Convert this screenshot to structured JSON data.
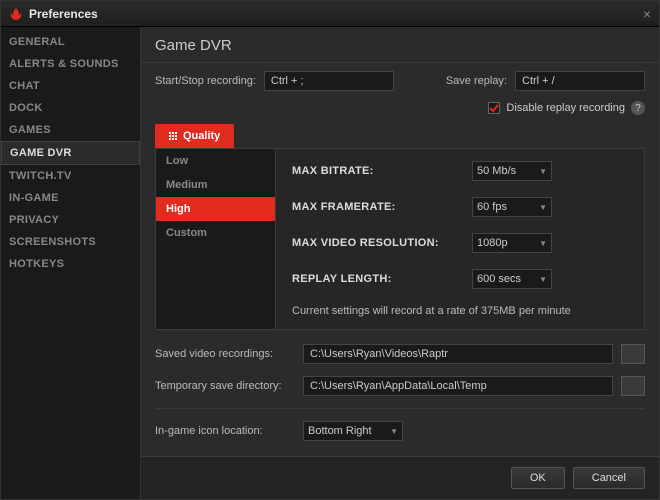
{
  "window": {
    "title": "Preferences"
  },
  "sidebar": {
    "items": [
      {
        "label": "GENERAL"
      },
      {
        "label": "ALERTS & SOUNDS"
      },
      {
        "label": "CHAT"
      },
      {
        "label": "DOCK"
      },
      {
        "label": "GAMES"
      },
      {
        "label": "GAME DVR",
        "active": true
      },
      {
        "label": "TWITCH.TV"
      },
      {
        "label": "IN-GAME"
      },
      {
        "label": "PRIVACY"
      },
      {
        "label": "SCREENSHOTS"
      },
      {
        "label": "HOTKEYS"
      }
    ]
  },
  "header": {
    "title": "Game DVR"
  },
  "recording": {
    "start_label": "Start/Stop recording:",
    "start_value": "Ctrl + ;",
    "save_label": "Save replay:",
    "save_value": "Ctrl + /",
    "disable_label": "Disable replay recording",
    "disable_checked": true
  },
  "tab": {
    "label": "Quality"
  },
  "quality": {
    "options": [
      {
        "label": "Low"
      },
      {
        "label": "Medium"
      },
      {
        "label": "High",
        "selected": true
      },
      {
        "label": "Custom"
      }
    ],
    "bitrate_label": "MAX BITRATE:",
    "bitrate_value": "50 Mb/s",
    "framerate_label": "MAX FRAMERATE:",
    "framerate_value": "60 fps",
    "resolution_label": "MAX VIDEO RESOLUTION:",
    "resolution_value": "1080p",
    "replay_label": "REPLAY LENGTH:",
    "replay_value": "600 secs",
    "note": "Current settings will record at a rate of 375MB per minute"
  },
  "paths": {
    "saved_label": "Saved video recordings:",
    "saved_value": "C:\\Users\\Ryan\\Videos\\Raptr",
    "temp_label": "Temporary save directory:",
    "temp_value": "C:\\Users\\Ryan\\AppData\\Local\\Temp"
  },
  "icon_location": {
    "label": "In-game icon location:",
    "value": "Bottom Right"
  },
  "footer": {
    "ok": "OK",
    "cancel": "Cancel"
  }
}
